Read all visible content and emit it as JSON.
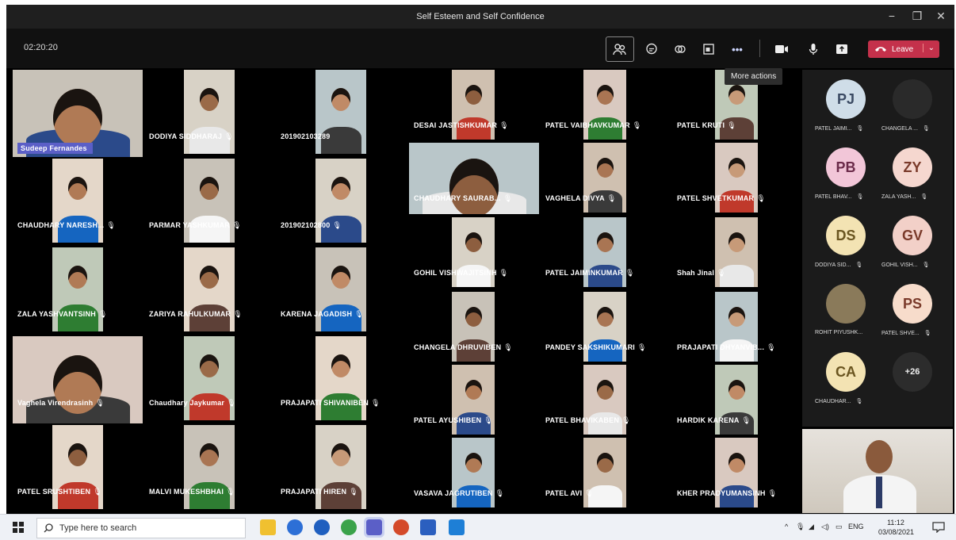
{
  "window": {
    "title": "Self Esteem and Self Confidence",
    "minimize": "−",
    "restore": "❐",
    "close": "✕"
  },
  "toolbar": {
    "timer": "02:20:20",
    "participants_icon": "people-icon",
    "chat_icon": "chat-icon",
    "reactions_icon": "raise-hand-icon",
    "rooms_icon": "breakout-rooms-icon",
    "more_label": "•••",
    "camera_icon": "camera-icon",
    "mic_icon": "mic-icon",
    "share_icon": "share-icon",
    "leave_label": "Leave",
    "leave_chevron": "⌄",
    "tooltip": "More actions"
  },
  "participants": [
    {
      "name": "Sudeep Fernandes",
      "mic": ""
    },
    {
      "name": "DODIYA SIDDHARAJ",
      "mic": "🎙"
    },
    {
      "name": "201902103289",
      "mic": ""
    },
    {
      "name": "DESAI JASTISHKUMAR",
      "mic": "🎙"
    },
    {
      "name": "PATEL VAIBHAVKUMAR",
      "mic": "🎙"
    },
    {
      "name": "PATEL KRUTI",
      "mic": "🎙"
    },
    {
      "name": "CHAUDHARY NARESH...",
      "mic": "🎙"
    },
    {
      "name": "PARMAR YASHKUMAR",
      "mic": "🎙"
    },
    {
      "name": "201902102800",
      "mic": "🎙"
    },
    {
      "name": "CHAUDHARY SAURAB...",
      "mic": "🎙"
    },
    {
      "name": "VAGHELA DIVYA",
      "mic": "🎙"
    },
    {
      "name": "PATEL SHVETKUMAR",
      "mic": "🎙"
    },
    {
      "name": "ZALA YASHVANTSINH",
      "mic": "🎙"
    },
    {
      "name": "ZARIYA RAHULKUMAR",
      "mic": "🎙"
    },
    {
      "name": "KARENA JAGADISH",
      "mic": "🎙"
    },
    {
      "name": "GOHIL VISHWAJITSINH",
      "mic": "🎙"
    },
    {
      "name": "PATEL JAIMINKUMAR",
      "mic": "🎙"
    },
    {
      "name": "Shah Jinal",
      "mic": "🎙"
    },
    {
      "name": "Vaghela Virendrasinh",
      "mic": "🎙"
    },
    {
      "name": "Chaudhary Jaykumar",
      "mic": "🎙"
    },
    {
      "name": "PRAJAPATI SHIVANIBEN",
      "mic": "🎙"
    },
    {
      "name": "CHANGELA DHRUVIBEN",
      "mic": "🎙"
    },
    {
      "name": "PANDEY SAKSHIKUMARI",
      "mic": "🎙"
    },
    {
      "name": "PRAJAPATI DHYANVIB...",
      "mic": "🎙"
    },
    {
      "name": "PATEL AYUSHIBEN",
      "mic": "🎙"
    },
    {
      "name": "PATEL BHAVIKABEN",
      "mic": "🎙"
    },
    {
      "name": "HARDIK KARENA",
      "mic": "🎙"
    },
    {
      "name": "PATEL SRUSHTIBEN",
      "mic": "🎙"
    },
    {
      "name": "MALVI MUKESHBHAI",
      "mic": "🎙"
    },
    {
      "name": "PRAJAPATI HIREN",
      "mic": "🎙"
    },
    {
      "name": "VASAVA JAGRUTIBEN",
      "mic": "🎙"
    },
    {
      "name": "PATEL AVI",
      "mic": "🎙"
    },
    {
      "name": "KHER PRADYUMANSINH",
      "mic": "🎙"
    }
  ],
  "roster": [
    {
      "initials": "PJ",
      "name": "PATEL JAIMI...",
      "mic": "🎙",
      "bg": "#cfdde8",
      "fg": "#3b4a63"
    },
    {
      "initials": "",
      "name": "CHANGELA ...",
      "mic": "🎙",
      "bg": "#2a2a2a",
      "fg": "#e05a7a"
    },
    {
      "initials": "PB",
      "name": "PATEL BHAV...",
      "mic": "🎙",
      "bg": "#f2c6d8",
      "fg": "#6b2b4a"
    },
    {
      "initials": "ZY",
      "name": "ZALA YASH...",
      "mic": "🎙",
      "bg": "#f5d7cf",
      "fg": "#7a3a2a"
    },
    {
      "initials": "DS",
      "name": "DODIYA SID...",
      "mic": "🎙",
      "bg": "#f3e3b3",
      "fg": "#6a5520"
    },
    {
      "initials": "GV",
      "name": "GOHIL VISH...",
      "mic": "🎙",
      "bg": "#f2d0c8",
      "fg": "#7a3a2a"
    },
    {
      "initials": "",
      "name": "ROHIT PIYUSHK...",
      "mic": "",
      "bg": "#8a7a5a",
      "fg": "#fff"
    },
    {
      "initials": "PS",
      "name": "PATEL SHVE...",
      "mic": "🎙",
      "bg": "#f7dccb",
      "fg": "#7a3a2a"
    },
    {
      "initials": "CA",
      "name": "CHAUDHAR...",
      "mic": "🎙",
      "bg": "#f3e3b3",
      "fg": "#6a5520"
    },
    {
      "initials": "+26",
      "name": "",
      "mic": "",
      "bg": "#2c2c2c",
      "fg": "#eeeeee"
    }
  ],
  "taskbar": {
    "search_placeholder": "Type here to search",
    "time": "11:12",
    "date": "03/08/2021",
    "lang": "ENG"
  }
}
